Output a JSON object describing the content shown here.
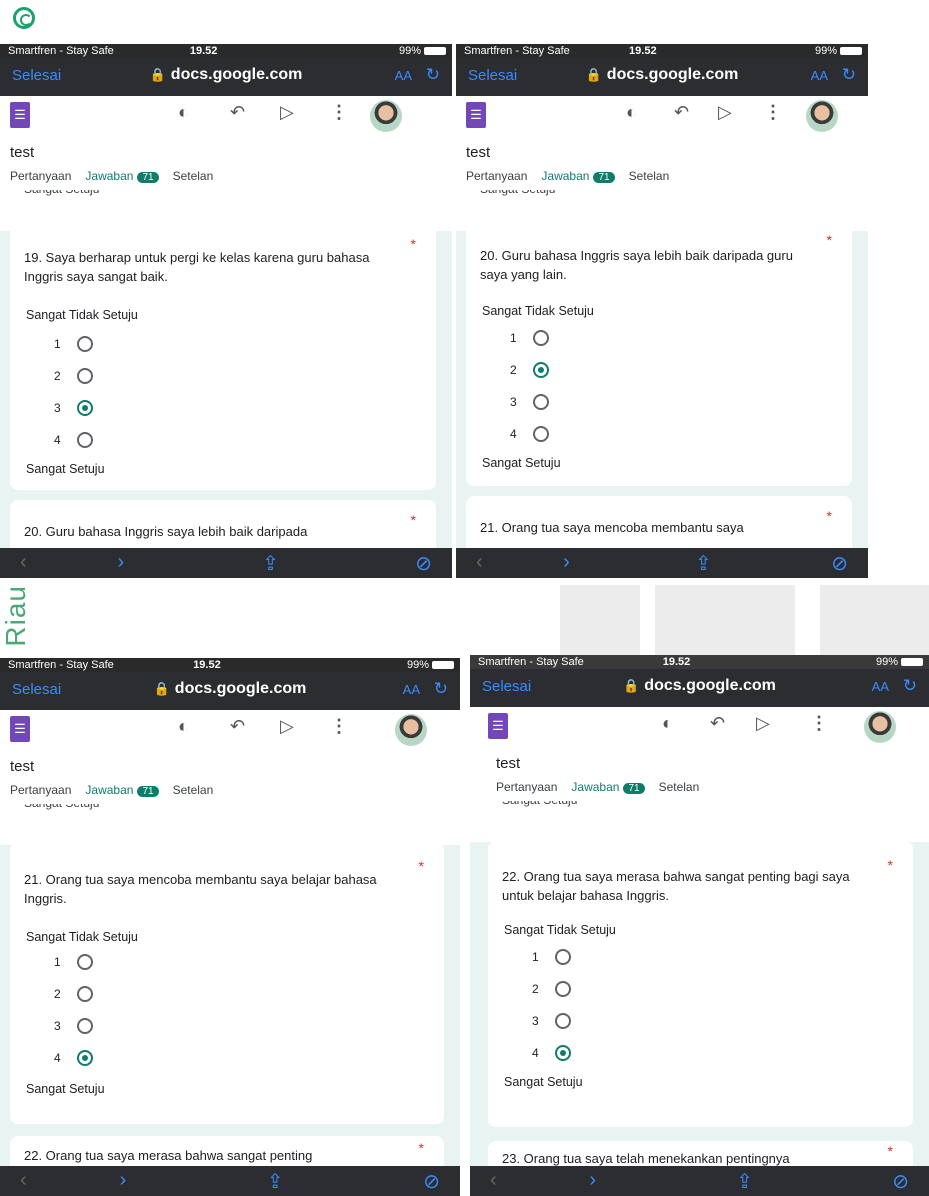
{
  "page": {
    "watermark_side_text": "Riau"
  },
  "shared": {
    "carrier": "Smartfren - Stay Safe",
    "time": "19.52",
    "battery": "99%",
    "done_label": "Selesai",
    "url": "docs.google.com",
    "aa_label": "AA",
    "form_title": "test",
    "tab_questions": "Pertanyaan",
    "tab_responses": "Jawaban",
    "response_count": "71",
    "tab_settings": "Setelan",
    "scale_low": "Sangat Tidak Setuju",
    "scale_high": "Sangat Setuju",
    "required_mark": "*",
    "options": [
      "1",
      "2",
      "3",
      "4"
    ]
  },
  "screens": [
    {
      "question": "19. Saya berharap untuk pergi ke kelas karena guru bahasa Inggris saya sangat baik.",
      "selected_option": "3",
      "next_question": "20. Guru bahasa Inggris saya lebih baik daripada"
    },
    {
      "question": "20. Guru bahasa Inggris saya lebih baik daripada guru saya yang lain.",
      "selected_option": "2",
      "next_question": "21. Orang tua saya mencoba membantu saya"
    },
    {
      "question": "21. Orang tua saya mencoba membantu saya belajar bahasa Inggris.",
      "selected_option": "4",
      "next_question": "22. Orang tua saya merasa bahwa sangat penting"
    },
    {
      "question": "22. Orang tua saya merasa bahwa sangat penting bagi saya untuk belajar bahasa Inggris.",
      "selected_option": "4",
      "next_question": "23. Orang tua saya telah menekankan pentingnya"
    }
  ]
}
